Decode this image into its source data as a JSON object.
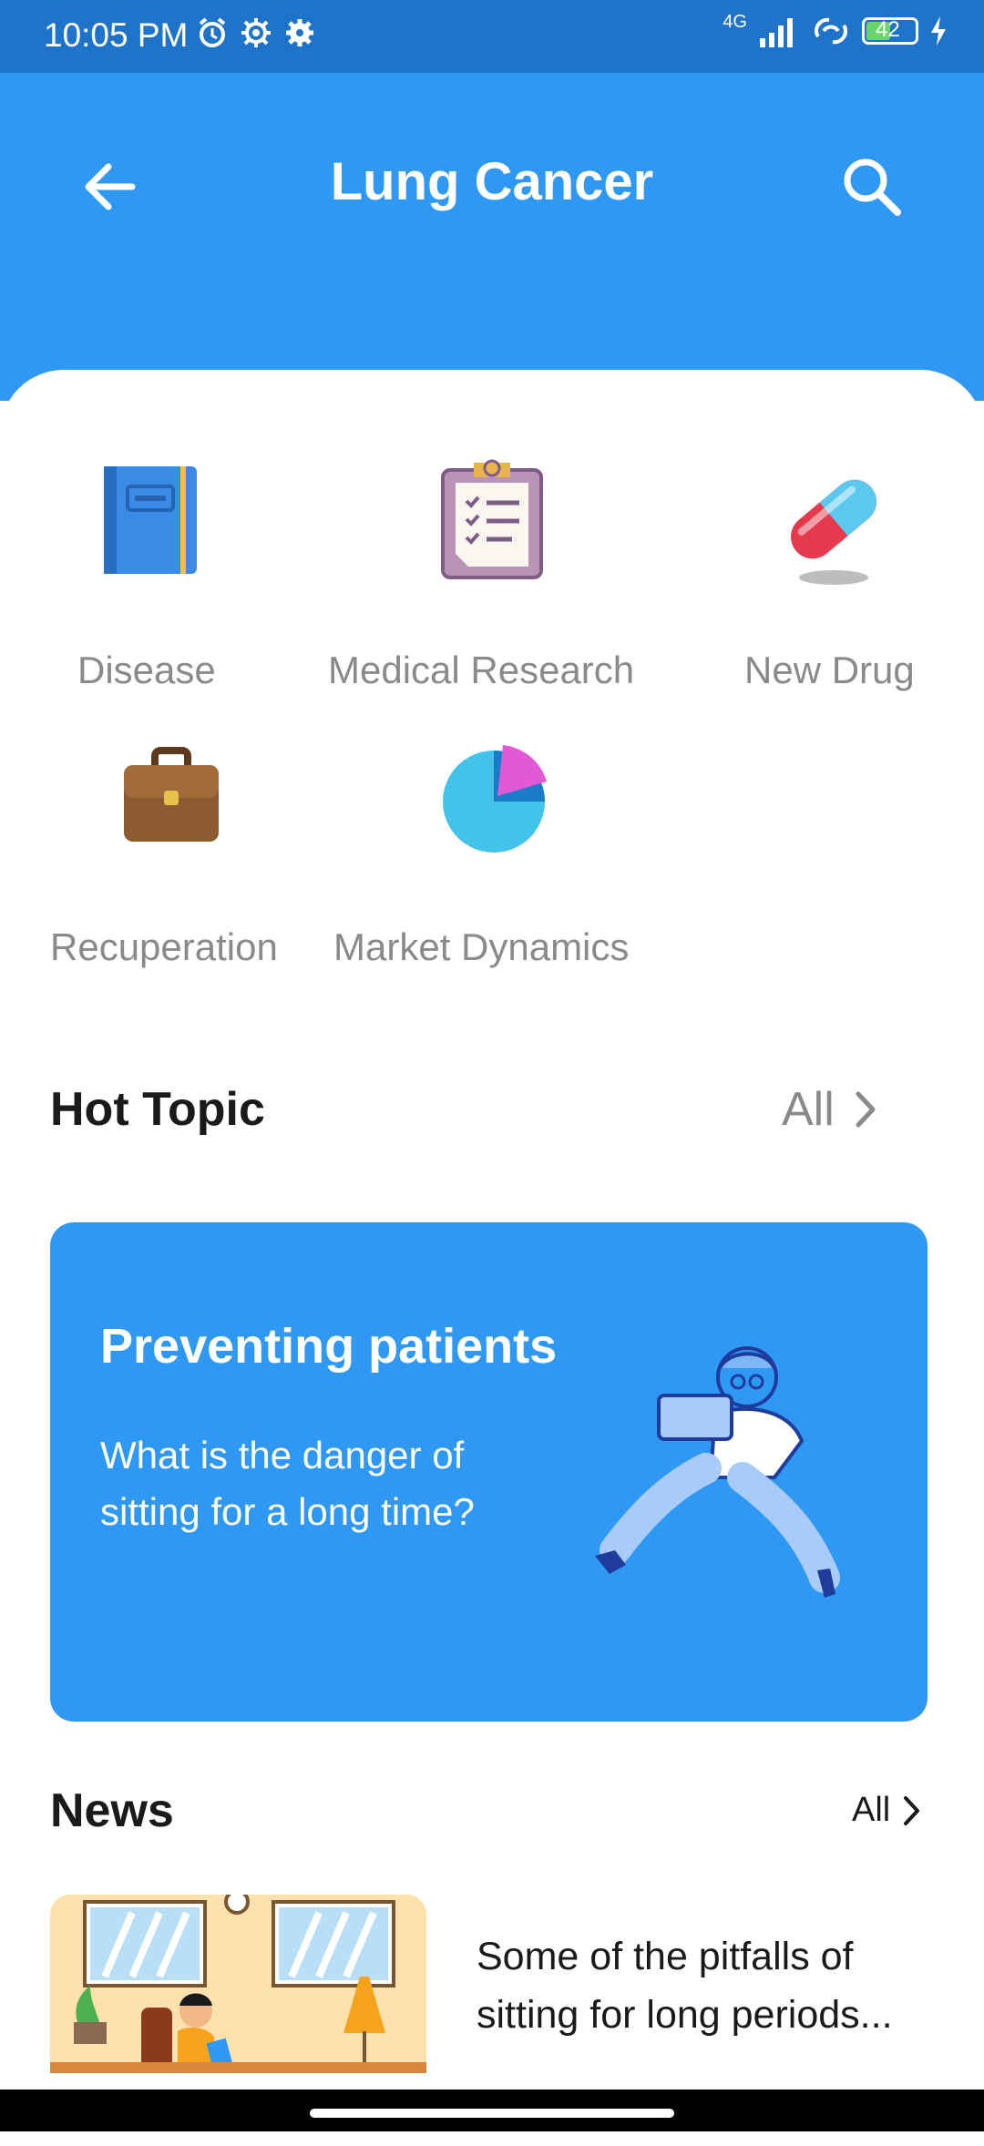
{
  "status": {
    "time": "10:05 PM",
    "network": "4G",
    "battery": "42"
  },
  "header": {
    "title": "Lung Cancer"
  },
  "categories": [
    {
      "label": "Disease",
      "icon": "book-icon"
    },
    {
      "label": "Medical Research",
      "icon": "clipboard-icon"
    },
    {
      "label": "New Drug",
      "icon": "pill-icon"
    },
    {
      "label": "Recuperation",
      "icon": "briefcase-icon"
    },
    {
      "label": "Market Dynamics",
      "icon": "pie-chart-icon"
    }
  ],
  "hot_topic": {
    "title": "Hot Topic",
    "all_label": "All",
    "card": {
      "title": "Preventing patients",
      "description": "What is the danger of sitting for a long time?"
    }
  },
  "news": {
    "title": "News",
    "all_label": "All",
    "items": [
      {
        "text": "Some of the pitfalls of sitting for long periods..."
      }
    ]
  },
  "colors": {
    "header": "#2e98f2",
    "statusbar": "#1f74c9",
    "card": "#2e98f2"
  }
}
